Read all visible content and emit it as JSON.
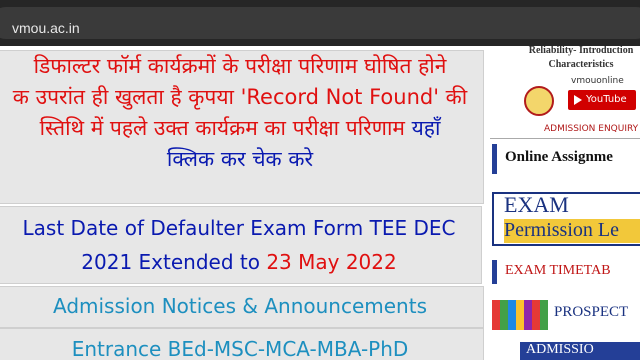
{
  "browser": {
    "url": "vmou.ac.in"
  },
  "main": {
    "hindi_notice": {
      "line1": "डिफाल्टर फॉर्म कार्यक्रमों के परीक्षा परिणाम घोषित होने",
      "line2": "क उपरांत ही खुलता है कृपया 'Record Not Found' की",
      "line3_red": "स्तिथि में पहले उक्त कार्यक्रम का परीक्षा परिणाम",
      "line3_link": "यहाँ",
      "line4_link": "क्लिक कर चेक करे"
    },
    "last_date": {
      "line1": "Last Date of Defaulter Exam Form TEE DEC",
      "line2_prefix": "2021 Extended to",
      "line2_date": "23 May 2022"
    },
    "admission_notices": "Admission Notices & Announcements",
    "entrance": "Entrance BEd-MSC-MCA-MBA-PhD"
  },
  "sidebar": {
    "reliability_text": "Reliability- Introduction Characteristics",
    "channel_name": "vmouonline",
    "youtube_label": "YouTube",
    "admission_enquiry": "ADMISSION ENQUIRY",
    "online_assignment": "Online Assignme",
    "exam_title": "EXAM",
    "exam_permission": "Permission Le",
    "exam_timetable": "EXAM TIMETAB",
    "prospectus": "PROSPECT",
    "admission": "ADMISSIO"
  },
  "colors": {
    "red": "#e01010",
    "blue": "#0a1ab0",
    "link_blue": "#1d8fbf",
    "box_bg": "#e7e7e7"
  }
}
